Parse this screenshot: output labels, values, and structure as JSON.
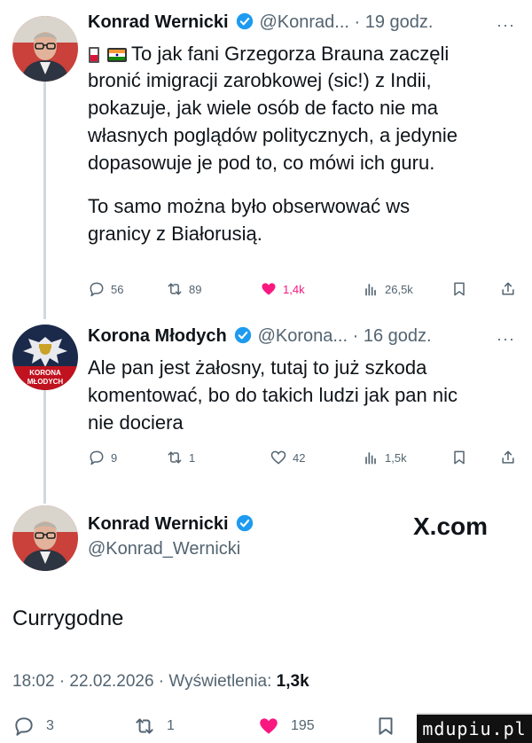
{
  "tweet1": {
    "author": "Konrad Wernicki",
    "meta": "@Konrad... · 19 godz.",
    "more": "···",
    "line1": "To jak fani Grzegorza Brauna zaczęli",
    "line2": "bronić imigracji zarobkowej (sic!) z Indii,",
    "line3": "pokazuje, jak wiele osób de facto nie ma",
    "line4": "własnych poglądów politycznych, a jedynie",
    "line5": "dopasowuje je pod to, co mówi ich guru.",
    "line6": "To samo można było obserwować ws",
    "line7": "granicy z Białorusią.",
    "replies": "56",
    "reposts": "89",
    "likes": "1,4k",
    "views": "26,5k",
    "flags": [
      "poland-flag-icon",
      "india-flag-icon"
    ]
  },
  "tweet2": {
    "author": "Korona Młodych",
    "meta": "@Korona... · 16 godz.",
    "more": "···",
    "line1": "Ale pan jest żałosny, tutaj to już szkoda",
    "line2": "komentować, bo do takich ludzi jak pan nic",
    "line3": "nie dociera",
    "replies": "9",
    "reposts": "1",
    "likes": "42",
    "views": "1,5k",
    "avatar_text_top": "KORONA",
    "avatar_text_bottom": "MŁODYCH"
  },
  "reply": {
    "author": "Konrad Wernicki",
    "handle": "@Konrad_Wernicki",
    "brand": "X.com",
    "text": "Currygodne",
    "timestamp": "18:02 · 22.02.2026 · Wyświetlenia: ",
    "views": "1,3k",
    "replies": "3",
    "reposts": "1",
    "likes": "195"
  },
  "watermark": "mdupiu.pl",
  "colors": {
    "verified": "#1d9bf0",
    "like": "#f91880",
    "muted": "#536471",
    "line": "#cfd9de"
  }
}
